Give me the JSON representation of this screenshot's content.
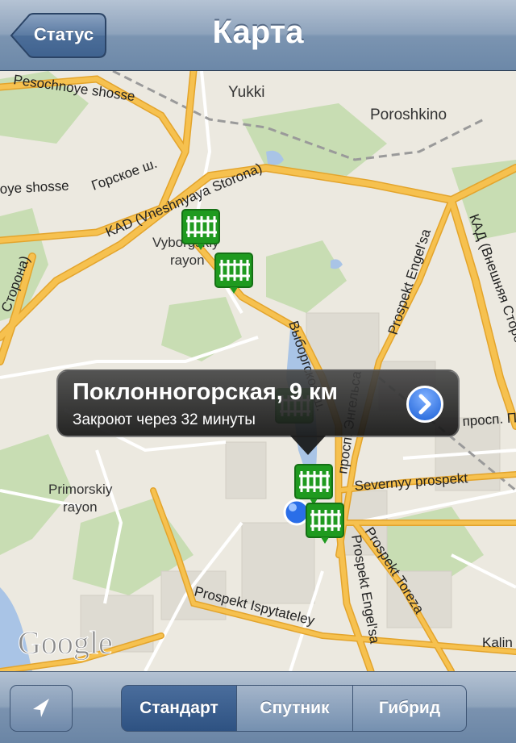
{
  "nav": {
    "title": "Карта",
    "back_label": "Статус"
  },
  "map": {
    "labels": {
      "yukki": "Yukki",
      "poroshkino": "Poroshkino",
      "vyborg_rayon_1": "Vyborgskiy",
      "vyborg_rayon_2": "rayon",
      "primorskiy_1": "Primorskiy",
      "primorskiy_2": "rayon",
      "google": "Google"
    },
    "roads": {
      "pesochnoye": "Pesochnoye shosse",
      "oye_shosse": "oye shosse",
      "gorskoe": "Горское ш.",
      "kad_vnesh": "KAD (Vneshnyaya Storona)",
      "kad_vnesh_ru": "КАД (Внешняя Сторона)",
      "storona_left": "Сторона)",
      "vyborgskoe": "Выборгское ш.",
      "engelsa": "Prospekt Engel'sa",
      "engelsa_lower": "Prospekt Engel'sa",
      "prosp_engelsa_ru": "просп. Энгельса",
      "severnyy": "Severnyy prospekt",
      "prosp_ru": "просп. П",
      "toreza": "Prospekt Toreza",
      "ispytateley": "Prospekt Ispytateley",
      "kalinin": "Kalin"
    }
  },
  "callout": {
    "title": "Поклонногорская, 9 км",
    "subtitle": "Закроют через 32 минуты"
  },
  "toolbar": {
    "segments": [
      "Стандарт",
      "Спутник",
      "Гибрид"
    ],
    "selected": "Стандарт"
  },
  "colors": {
    "road": "#f4b637",
    "marker": "#1f9a1f",
    "water": "#a9c4e6",
    "park": "#c6dcb0"
  }
}
